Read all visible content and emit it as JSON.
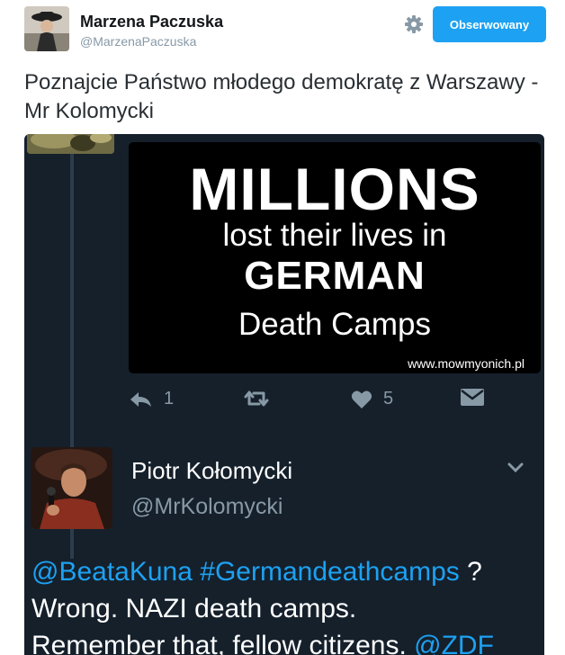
{
  "tweet": {
    "author_name": "Marzena Paczuska",
    "author_handle": "@MarzenaPaczuska",
    "follow_label": "Obserwowany",
    "text": "Poznajcie Państwo młodego demokratę z Warszawy - Mr Kolomycki"
  },
  "quoted": {
    "image_text": {
      "line1": "MILLIONS",
      "line2": "lost their lives in",
      "line3": "GERMAN",
      "line4": "Death Camps",
      "url": "www.mowmyonich.pl"
    },
    "reply_count": "1",
    "like_count": "5"
  },
  "reply": {
    "author_name": "Piotr Kołomycki",
    "author_handle": "@MrKolomycki",
    "mention": "@BeataKuna",
    "hashtag": "#Germandeathcamps",
    "text_after_tags": " ?",
    "line2": "Wrong. NAZI death camps.",
    "line3_start": "Remember that, fellow citizens. ",
    "line3_mention": "@ZDF"
  },
  "colors": {
    "follow_button": "#1da1f2",
    "dark_card": "#15202b",
    "link": "#1da1f2",
    "muted": "#8899a6"
  },
  "icons": [
    "gear-icon",
    "reply-icon",
    "retweet-icon",
    "heart-icon",
    "message-icon",
    "chevron-down-icon"
  ]
}
